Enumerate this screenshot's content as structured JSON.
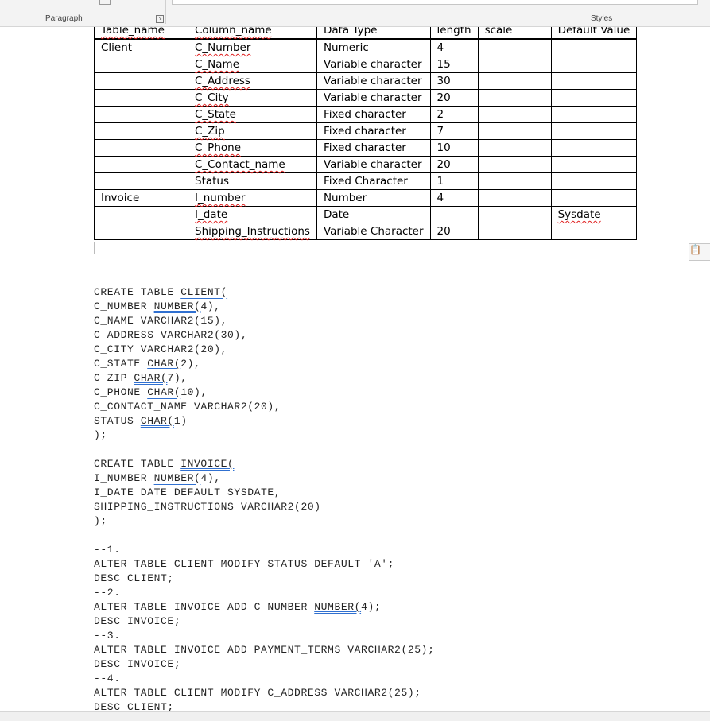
{
  "ribbon": {
    "paragraph_label": "Paragraph",
    "styles_label": "Styles"
  },
  "table": {
    "headers": [
      "Table_name",
      "Column_name",
      "Data Type",
      "length",
      "scale",
      "Default Value"
    ],
    "rows": [
      [
        "Client",
        "C_Number",
        "Numeric",
        "4",
        "",
        ""
      ],
      [
        "",
        "C_Name",
        "Variable character",
        "15",
        "",
        ""
      ],
      [
        "",
        "C_Address",
        "Variable character",
        "30",
        "",
        ""
      ],
      [
        "",
        "C_City",
        "Variable character",
        "20",
        "",
        ""
      ],
      [
        "",
        "C_State",
        "Fixed character",
        "2",
        "",
        ""
      ],
      [
        "",
        "C_Zip",
        "Fixed character",
        "7",
        "",
        ""
      ],
      [
        "",
        "C_Phone",
        "Fixed character",
        "10",
        "",
        ""
      ],
      [
        "",
        "C_Contact_name",
        "Variable character",
        "20",
        "",
        ""
      ],
      [
        "",
        "Status",
        "Fixed Character",
        "1",
        "",
        ""
      ],
      [
        "Invoice",
        "I_number",
        "Number",
        "4",
        "",
        ""
      ],
      [
        "",
        "I_date",
        "Date",
        "",
        "",
        "Sysdate"
      ],
      [
        "",
        "Shipping_Instructions",
        "Variable Character",
        "20",
        "",
        ""
      ]
    ]
  },
  "code": [
    [
      [
        "CREATE TABLE "
      ],
      [
        "CLIENT(",
        1
      ]
    ],
    [
      [
        "C_NUMBER "
      ],
      [
        "NUMBER(",
        1
      ],
      [
        "4),"
      ]
    ],
    [
      [
        "C_NAME VARCHAR2(15),"
      ]
    ],
    [
      [
        "C_ADDRESS VARCHAR2(30),"
      ]
    ],
    [
      [
        "C_CITY VARCHAR2(20),"
      ]
    ],
    [
      [
        "C_STATE "
      ],
      [
        "CHAR(",
        1
      ],
      [
        "2),"
      ]
    ],
    [
      [
        "C_ZIP "
      ],
      [
        "CHAR(",
        1
      ],
      [
        "7),"
      ]
    ],
    [
      [
        "C_PHONE "
      ],
      [
        "CHAR(",
        1
      ],
      [
        "10),"
      ]
    ],
    [
      [
        "C_CONTACT_NAME VARCHAR2(20),"
      ]
    ],
    [
      [
        "STATUS "
      ],
      [
        "CHAR(",
        1
      ],
      [
        "1)"
      ]
    ],
    [
      [
        ");"
      ]
    ],
    [
      [
        ""
      ]
    ],
    [
      [
        "CREATE TABLE "
      ],
      [
        "INVOICE(",
        1
      ]
    ],
    [
      [
        "I_NUMBER "
      ],
      [
        "NUMBER(",
        1
      ],
      [
        "4),"
      ]
    ],
    [
      [
        "I_DATE DATE DEFAULT SYSDATE,"
      ]
    ],
    [
      [
        "SHIPPING_INSTRUCTIONS VARCHAR2(20)"
      ]
    ],
    [
      [
        ");"
      ]
    ],
    [
      [
        ""
      ]
    ],
    [
      [
        "--1."
      ]
    ],
    [
      [
        "ALTER TABLE CLIENT MODIFY STATUS DEFAULT 'A';"
      ]
    ],
    [
      [
        "DESC CLIENT;"
      ]
    ],
    [
      [
        "--2."
      ]
    ],
    [
      [
        "ALTER TABLE INVOICE ADD C_NUMBER "
      ],
      [
        "NUMBER(",
        1
      ],
      [
        "4);"
      ]
    ],
    [
      [
        "DESC INVOICE;"
      ]
    ],
    [
      [
        "--3."
      ]
    ],
    [
      [
        "ALTER TABLE INVOICE ADD PAYMENT_TERMS VARCHAR2(25);"
      ]
    ],
    [
      [
        "DESC INVOICE;"
      ]
    ],
    [
      [
        "--4."
      ]
    ],
    [
      [
        "ALTER TABLE CLIENT MODIFY C_ADDRESS VARCHAR2(25);"
      ]
    ],
    [
      [
        "DESC CLIENT;"
      ]
    ]
  ]
}
